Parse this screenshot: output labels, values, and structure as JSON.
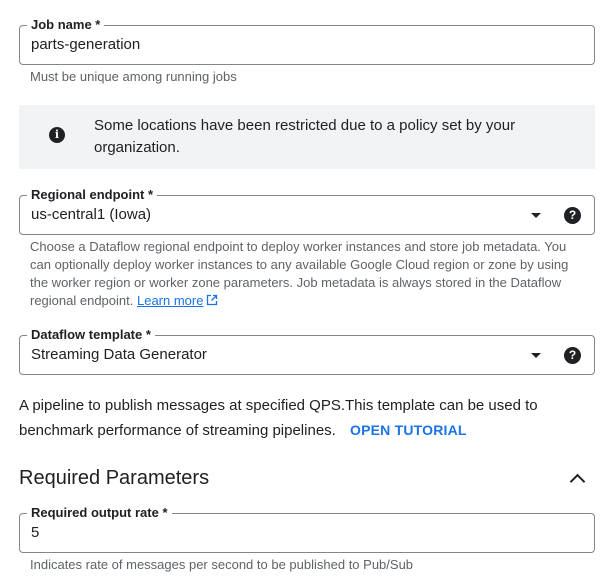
{
  "job_name": {
    "label": "Job name *",
    "value": "parts-generation",
    "hint": "Must be unique among running jobs"
  },
  "banner": {
    "icon": "info-icon",
    "text": "Some locations have been restricted due to a policy set by your organization."
  },
  "regional_endpoint": {
    "label": "Regional endpoint *",
    "value": "us-central1 (Iowa)",
    "hint": "Choose a Dataflow regional endpoint to deploy worker instances and store job metadata. You can optionally deploy worker instances to any available Google Cloud region or zone by using the worker region or worker zone parameters. Job metadata is always stored in the Dataflow regional endpoint.",
    "learn_more": "Learn more"
  },
  "dataflow_template": {
    "label": "Dataflow template *",
    "value": "Streaming Data Generator"
  },
  "description": {
    "text": "A pipeline to publish messages at specified QPS.This template can be used to benchmark performance of streaming pipelines.",
    "tutorial_link": "OPEN TUTORIAL"
  },
  "required_parameters": {
    "title": "Required Parameters",
    "output_rate": {
      "label": "Required output rate *",
      "value": "5",
      "hint": "Indicates rate of messages per second to be published to Pub/Sub"
    }
  },
  "colors": {
    "link": "#1a73e8",
    "text": "#202124",
    "hint": "#5f6368",
    "banner_bg": "#f1f3f4",
    "border": "#80868b"
  }
}
